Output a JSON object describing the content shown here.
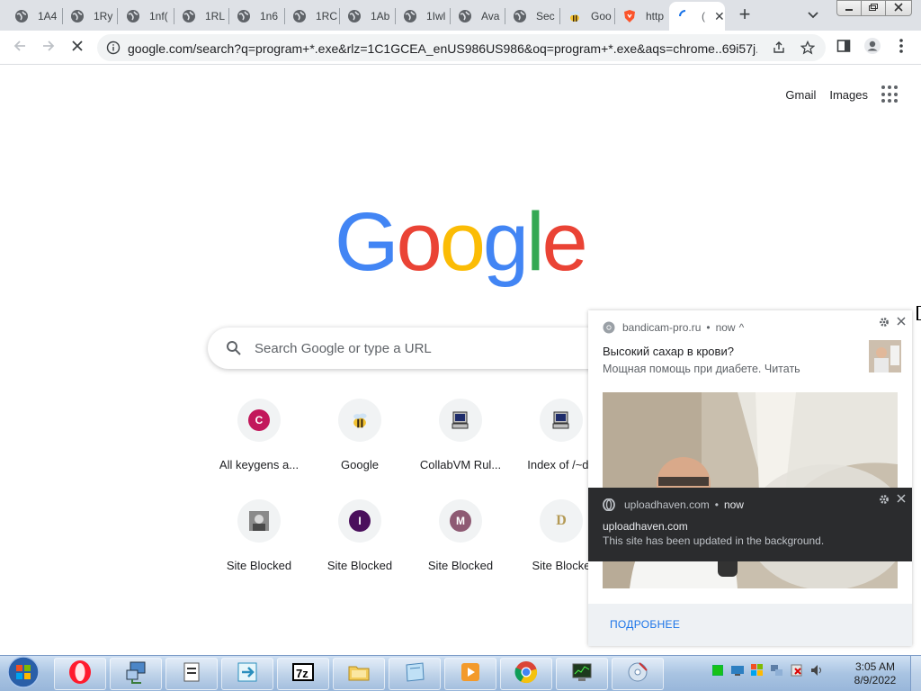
{
  "browser": {
    "tabs": [
      {
        "title": "1A4",
        "icon": "globe-icon"
      },
      {
        "title": "1Ry",
        "icon": "globe-icon"
      },
      {
        "title": "1nf(",
        "icon": "globe-icon"
      },
      {
        "title": "1RL",
        "icon": "globe-icon"
      },
      {
        "title": "1n6",
        "icon": "globe-icon"
      },
      {
        "title": "1RC",
        "icon": "globe-icon"
      },
      {
        "title": "1Ab",
        "icon": "globe-icon"
      },
      {
        "title": "1Iwl",
        "icon": "globe-icon"
      },
      {
        "title": "Ava",
        "icon": "globe-icon"
      },
      {
        "title": "Sec",
        "icon": "globe-icon"
      },
      {
        "title": "Goo",
        "icon": "bee-icon"
      },
      {
        "title": "http",
        "icon": "brave-shield-icon"
      },
      {
        "title": "(",
        "icon": "loading-spinner-icon",
        "active": true
      }
    ],
    "new_tab_symbol": "+",
    "tab_close_symbol": "✕",
    "address": "google.com/search?q=program+*.exe&rlz=1C1GCEA_enUS986US986&oq=program+*.exe&aqs=chrome..69i57j..."
  },
  "google": {
    "top_links": {
      "gmail": "Gmail",
      "images": "Images"
    },
    "search_placeholder": "Search Google or type a URL",
    "shortcuts": [
      {
        "label": "All keygens a...",
        "icon": "letter",
        "letter": "C",
        "color": "#c2185b"
      },
      {
        "label": "Google",
        "icon": "bee-icon"
      },
      {
        "label": "CollabVM Rul...",
        "icon": "computer-icon"
      },
      {
        "label": "Index of /~da",
        "icon": "computer-icon"
      },
      {
        "label": "Site Blocked",
        "icon": "photo-icon"
      },
      {
        "label": "Site Blocked",
        "icon": "letter",
        "letter": "I",
        "color": "#4a0f5c"
      },
      {
        "label": "Site Blocked",
        "icon": "letter",
        "letter": "M",
        "color": "#8e5a73"
      },
      {
        "label": "Site Blocke",
        "icon": "letter",
        "letter": "D",
        "color": "#f1f3f4",
        "text_color": "#b49a55"
      }
    ]
  },
  "notification_1": {
    "source": "bandicam-pro.ru",
    "dot": "•",
    "time": "now",
    "chevron": "^",
    "title": "Высокий сахар в крови?",
    "message": "Мощная помощь при диабете. Читать",
    "action": "ПОДРОБНЕЕ"
  },
  "notification_2": {
    "source": "uploadhaven.com",
    "dot": "•",
    "time": "now",
    "title": "uploadhaven.com",
    "message": "This site has been updated in the background."
  },
  "taskbar": {
    "time": "3:05 AM",
    "date": "8/9/2022",
    "apps": [
      "opera-icon",
      "network-computer-icon",
      "notepad-icon",
      "transfer-icon",
      "7zip-icon",
      "folder-icon",
      "notes-icon",
      "media-player-icon",
      "chrome-icon",
      "task-monitor-icon",
      "disc-tool-icon"
    ]
  }
}
